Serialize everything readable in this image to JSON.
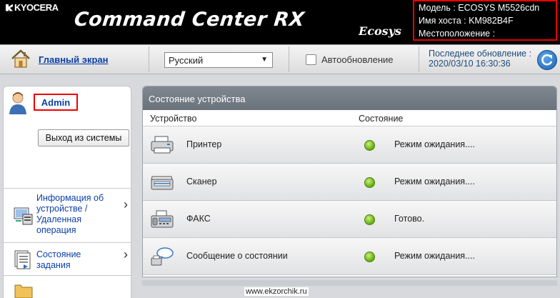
{
  "header": {
    "brand": "KYOCERA",
    "product": "Command Center RX",
    "sub_brand": "Ecosys",
    "info": {
      "model": "Модель : ECOSYS M5526cdn",
      "host": "Имя хоста : KM982B4F",
      "location": "Местоположение :"
    }
  },
  "toolbar": {
    "home_label": "Главный экран",
    "language": "Русский",
    "auto_refresh_label": "Автообновление",
    "last_update_label": "Последнее обновление :",
    "last_update_value": "2020/03/10 16:30:36"
  },
  "sidebar": {
    "user": "Admin",
    "logout_label": "Выход из системы",
    "items": [
      {
        "label_lines": [
          "Информация об",
          "устройстве /",
          "Удаленная",
          "операция"
        ]
      },
      {
        "label_lines": [
          "Состояние",
          "задания"
        ]
      }
    ]
  },
  "main": {
    "title": "Состояние устройства",
    "col_device": "Устройство",
    "col_status": "Состояние",
    "rows": [
      {
        "name": "Принтер",
        "status": "Режим ожидания...."
      },
      {
        "name": "Сканер",
        "status": "Режим ожидания...."
      },
      {
        "name": "ФАКС",
        "status": "Готово."
      },
      {
        "name": "Сообщение о состоянии",
        "status": "Режим ожидания...."
      }
    ]
  },
  "watermark": "www.ekzorchik.ru",
  "colors": {
    "link": "#0b3fa8",
    "highlight": "#ee0000",
    "status_ok": "#6fb41a",
    "header_bg": "#000000",
    "panel_title": "#737b85"
  },
  "icons": {
    "home": "home-icon",
    "refresh": "refresh-icon",
    "user": "user-icon",
    "device_info": "device-info-icon",
    "job_status": "job-status-icon",
    "printer": "printer-icon",
    "scanner": "scanner-icon",
    "fax": "fax-icon",
    "message": "message-icon"
  }
}
